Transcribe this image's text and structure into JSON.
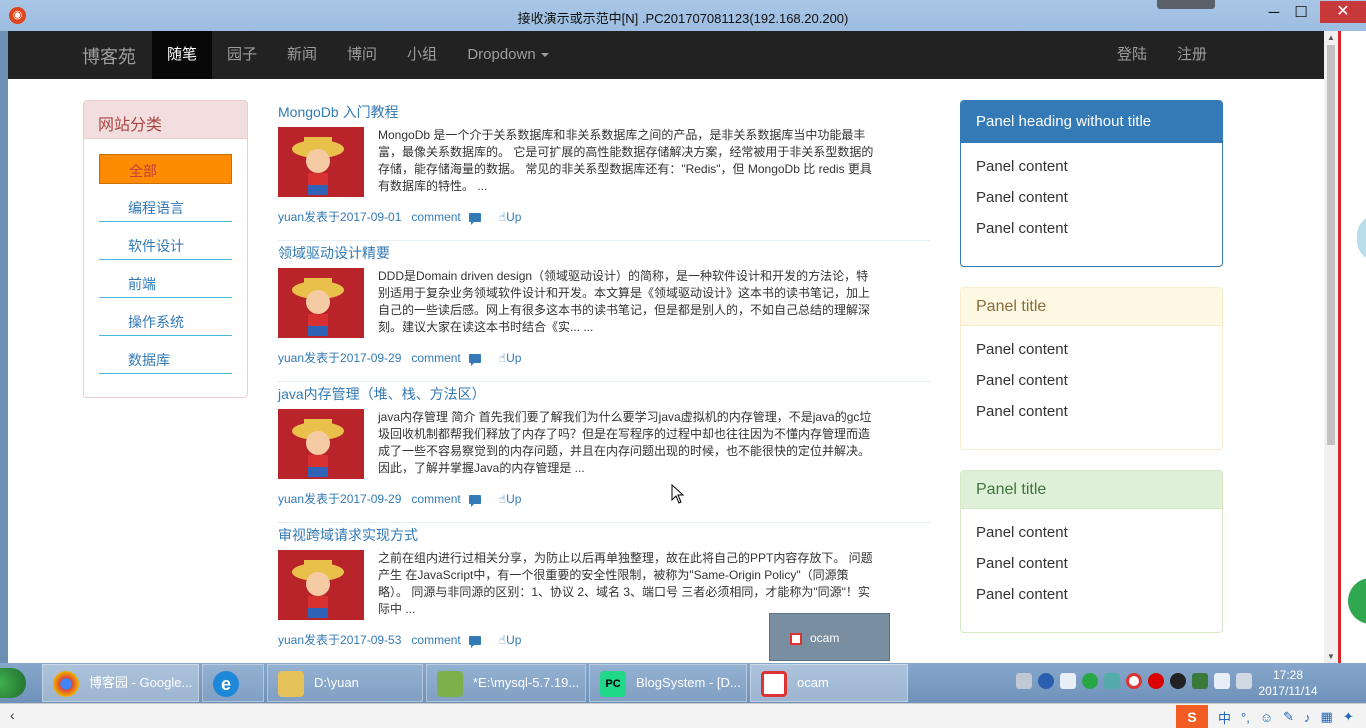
{
  "window": {
    "title": "接收演示或示范中[N] .PC201707081123(192.168.20.200)",
    "minimize": "─",
    "maximize": "☐",
    "close": "✕"
  },
  "navbar": {
    "brand": "博客苑",
    "items": [
      "随笔",
      "园子",
      "新闻",
      "博问",
      "小组"
    ],
    "dropdown": "Dropdown",
    "login": "登陆",
    "register": "注册"
  },
  "categories": {
    "heading": "网站分类",
    "items": [
      "全部",
      "编程语言",
      "软件设计",
      "前端",
      "操作系统",
      "数据库"
    ]
  },
  "articles": [
    {
      "title": "MongoDb 入门教程",
      "desc": "MongoDb 是一个介于关系数据库和非关系数据库之间的产品，是非关系数据库当中功能最丰富，最像关系数据库的。 它是可扩展的高性能数据存储解决方案，经常被用于非关系型数据的存储，能存储海量的数据。 常见的非关系型数据库还有：\"Redis\"，但 MongoDb 比 redis 更具有数据库的特性。 ...",
      "author_date": "yuan发表于2017-09-01",
      "comment": "comment",
      "up": "Up"
    },
    {
      "title": "领域驱动设计精要",
      "desc": "DDD是Domain driven design（领域驱动设计）的简称，是一种软件设计和开发的方法论，特别适用于复杂业务领域软件设计和开发。本文算是《领域驱动设计》这本书的读书笔记，加上自己的一些读后感。网上有很多这本书的读书笔记，但是都是别人的，不如自己总结的理解深刻。建议大家在读这本书时结合《实... ...",
      "author_date": "yuan发表于2017-09-29",
      "comment": "comment",
      "up": "Up"
    },
    {
      "title": "java内存管理（堆、栈、方法区）",
      "desc": "java内存管理 简介 首先我们要了解我们为什么要学习java虚拟机的内存管理，不是java的gc垃圾回收机制都帮我们释放了内存了吗？但是在写程序的过程中却也往往因为不懂内存管理而造成了一些不容易察觉到的内存问题，并且在内存问题出现的时候，也不能很快的定位并解决。因此，了解并掌握Java的内存管理是 ...",
      "author_date": "yuan发表于2017-09-29",
      "comment": "comment",
      "up": "Up"
    },
    {
      "title": "审视跨域请求实现方式",
      "desc": "之前在组内进行过相关分享，为防止以后再单独整理，故在此将自己的PPT内容存放下。 问题产生 在JavaScript中，有一个很重要的安全性限制，被称为\"Same-Origin Policy\"（同源策略）。 同源与非同源的区别：1、协议 2、域名 3、端口号 三者必须相同，才能称为\"同源\"！实际中 ...",
      "author_date": "yuan发表于2017-09-53",
      "comment": "comment",
      "up": "Up"
    }
  ],
  "panels": [
    {
      "heading": "Panel heading without title",
      "lines": [
        "Panel content",
        "Panel content",
        "Panel content"
      ]
    },
    {
      "heading": "Panel title",
      "lines": [
        "Panel content",
        "Panel content",
        "Panel content"
      ]
    },
    {
      "heading": "Panel title",
      "lines": [
        "Panel content",
        "Panel content",
        "Panel content"
      ]
    }
  ],
  "ocam_popup": "ocam",
  "taskbar": {
    "tasks": [
      {
        "label": "博客园 - Google...",
        "icon": "chrome-icon"
      },
      {
        "label": "",
        "icon": "ie-icon"
      },
      {
        "label": "D:\\yuan",
        "icon": "folder-icon"
      },
      {
        "label": "*E:\\mysql-5.7.19...",
        "icon": "notepad-icon"
      },
      {
        "label": "BlogSystem - [D...",
        "icon": "pycharm-icon"
      },
      {
        "label": "ocam",
        "icon": "ocam-icon"
      }
    ],
    "time": "17:28",
    "date": "2017/11/14"
  },
  "ime": {
    "logo": "S",
    "lang": "中",
    "punct": "°,"
  },
  "colors": {
    "navbar": "#222222",
    "link": "#337ab7",
    "primary": "#337ab7",
    "warning_bg": "#fcf8e3",
    "success_bg": "#dff0d8",
    "danger_bg": "#f2dede",
    "active_category": "#ff8c00"
  }
}
